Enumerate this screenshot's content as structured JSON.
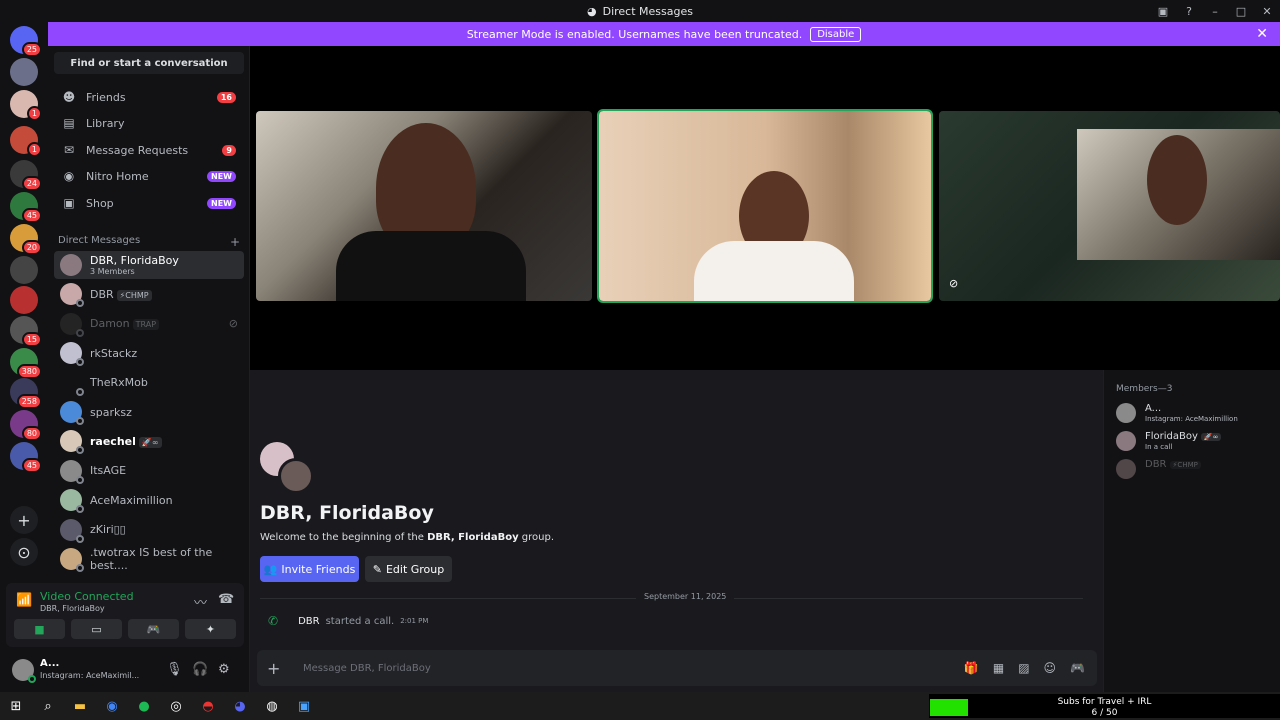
{
  "window": {
    "title": "Direct Messages"
  },
  "banner": {
    "text": "Streamer Mode is enabled. Usernames have been truncated.",
    "disable_label": "Disable"
  },
  "servers": [
    {
      "badge": "25",
      "color": "#5865f2"
    },
    {
      "badge": "",
      "color": "#6b6f8a"
    },
    {
      "badge": "1",
      "color": "#d9b8b0"
    },
    {
      "badge": "1",
      "color": "#c44a3a"
    },
    {
      "badge": "24",
      "color": "#3a3a3a"
    },
    {
      "badge": "45",
      "color": "#2e7a3e"
    },
    {
      "badge": "20",
      "color": "#d89c3a"
    },
    {
      "badge": "",
      "color": "#444"
    },
    {
      "badge": "",
      "color": "#b83030"
    },
    {
      "badge": "15",
      "color": "#555"
    },
    {
      "badge": "380",
      "color": "#3a8a4a"
    },
    {
      "badge": "258",
      "color": "#3a3a5a"
    },
    {
      "badge": "80",
      "color": "#7a3a8a"
    },
    {
      "badge": "45",
      "color": "#4a5aaa"
    }
  ],
  "sidebar": {
    "search_label": "Find or start a conversation",
    "nav": [
      {
        "label": "Friends",
        "pill": "16",
        "icon": "☻"
      },
      {
        "label": "Library",
        "pill": "",
        "icon": "▤"
      },
      {
        "label": "Message Requests",
        "pill": "9",
        "icon": "✉"
      },
      {
        "label": "Nitro Home",
        "pill": "NEW",
        "icon": "◉"
      },
      {
        "label": "Shop",
        "pill": "NEW",
        "icon": "▣"
      }
    ],
    "dm_header": "Direct Messages",
    "dms": [
      {
        "name": "DBR, FloridaBoy",
        "sub": "3 Members",
        "tag": "",
        "color": "#8a7a80"
      },
      {
        "name": "DBR",
        "sub": "",
        "tag": "⚡CHMP",
        "color": "#c8a8a8"
      },
      {
        "name": "Damon",
        "sub": "",
        "tag": "TRAP",
        "color": "#3a3a3a"
      },
      {
        "name": "rkStackz",
        "sub": "",
        "tag": "",
        "color": "#c0c0d0"
      },
      {
        "name": "TheRxMob",
        "sub": "",
        "tag": "",
        "color": "#121214"
      },
      {
        "name": "sparksz",
        "sub": "",
        "tag": "",
        "color": "#4a8ad8"
      },
      {
        "name": "raechel",
        "sub": "",
        "tag": "🚀∞",
        "color": "#d8c8b8"
      },
      {
        "name": "ItsAGE",
        "sub": "",
        "tag": "",
        "color": "#8a8a8a"
      },
      {
        "name": "AceMaximillion",
        "sub": "",
        "tag": "",
        "color": "#9ab8a0"
      },
      {
        "name": "zKiri▯▯",
        "sub": "",
        "tag": "",
        "color": "#5a5a6a"
      },
      {
        "name": ".twotrax IS best of the best....",
        "sub": "",
        "tag": "",
        "color": "#c8a880"
      }
    ]
  },
  "voice": {
    "status": "Video Connected",
    "channel": "DBR, FloridaBoy"
  },
  "user": {
    "name": "A...",
    "status": "Instagram: AceMaximil..."
  },
  "group": {
    "title": "DBR, FloridaBoy",
    "welcome_prefix": "Welcome to the beginning of the ",
    "welcome_name": "DBR, FloridaBoy",
    "welcome_suffix": " group.",
    "invite_label": "Invite Friends",
    "edit_label": "Edit Group"
  },
  "messages": {
    "date": "September 11, 2025",
    "call_user": "DBR",
    "call_text": "started a call.",
    "call_time": "2:01 PM"
  },
  "composer": {
    "placeholder": "Message DBR, FloridaBoy"
  },
  "members": {
    "header": "Members—3",
    "list": [
      {
        "name": "A...",
        "sub": "Instagram: AceMaximillion",
        "color": "#8a8a8a"
      },
      {
        "name": "FloridaBoy",
        "sub": "In a call",
        "tag": "🚀∞",
        "color": "#8a7a80"
      },
      {
        "name": "DBR",
        "sub": "",
        "tag": "⚡CHMP",
        "color": "#c8a8a8"
      }
    ]
  },
  "subs_widget": {
    "title": "Subs for Travel + IRL",
    "count": "6 / 50",
    "progress": 0.12
  }
}
